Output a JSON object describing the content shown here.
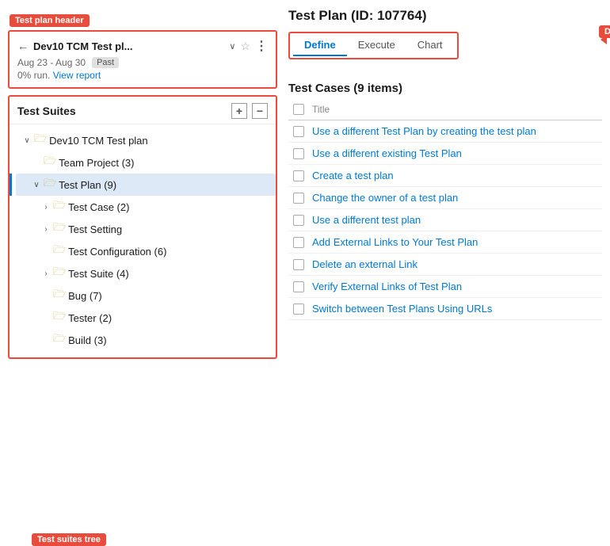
{
  "header": {
    "callout": "Test plan header",
    "back_label": "←",
    "plan_title": "Dev10 TCM Test pl...",
    "chevron": "∨",
    "star": "☆",
    "more": "⋮",
    "date_range": "Aug 23 - Aug 30",
    "past_badge": "Past",
    "progress": "0% run.",
    "view_report": "View report"
  },
  "suites": {
    "title": "Test Suites",
    "add_btn": "+",
    "collapse_btn": "−",
    "callout": "Test suites tree",
    "tree": [
      {
        "level": 1,
        "expand": "∨",
        "icon": "📁",
        "text": "Dev10 TCM Test plan",
        "selected": false
      },
      {
        "level": 2,
        "expand": "",
        "icon": "📁",
        "text": "Team Project (3)",
        "selected": false
      },
      {
        "level": 2,
        "expand": "∨",
        "icon": "📁",
        "text": "Test Plan (9)",
        "selected": true
      },
      {
        "level": 3,
        "expand": "›",
        "icon": "📁",
        "text": "Test Case (2)",
        "selected": false
      },
      {
        "level": 3,
        "expand": "›",
        "icon": "📁",
        "text": "Test Setting",
        "selected": false
      },
      {
        "level": 3,
        "expand": "",
        "icon": "📁",
        "text": "Test Configuration (6)",
        "selected": false
      },
      {
        "level": 3,
        "expand": "›",
        "icon": "📁",
        "text": "Test Suite (4)",
        "selected": false
      },
      {
        "level": 3,
        "expand": "",
        "icon": "📁",
        "text": "Bug (7)",
        "selected": false
      },
      {
        "level": 3,
        "expand": "",
        "icon": "📁",
        "text": "Tester (2)",
        "selected": false
      },
      {
        "level": 3,
        "expand": "",
        "icon": "📁",
        "text": "Build (3)",
        "selected": false
      }
    ]
  },
  "right": {
    "plan_id_title": "Test Plan (ID: 107764)",
    "tabs": [
      {
        "label": "Define",
        "active": true
      },
      {
        "label": "Execute",
        "active": false
      },
      {
        "label": "Chart",
        "active": false
      }
    ],
    "tabs_callout": "Define, Execute, and Chart tabs",
    "cases_title": "Test Cases (9 items)",
    "header_col": "Title",
    "cases": [
      {
        "text": "Use a different Test Plan by creating the test plan"
      },
      {
        "text": "Use a different existing Test Plan"
      },
      {
        "text": "Create a test plan"
      },
      {
        "text": "Change the owner of a test plan"
      },
      {
        "text": "Use a different test plan"
      },
      {
        "text": "Add External Links to Your Test Plan"
      },
      {
        "text": "Delete an external Link"
      },
      {
        "text": "Verify External Links of Test Plan"
      },
      {
        "text": "Switch between Test Plans Using URLs"
      }
    ]
  }
}
